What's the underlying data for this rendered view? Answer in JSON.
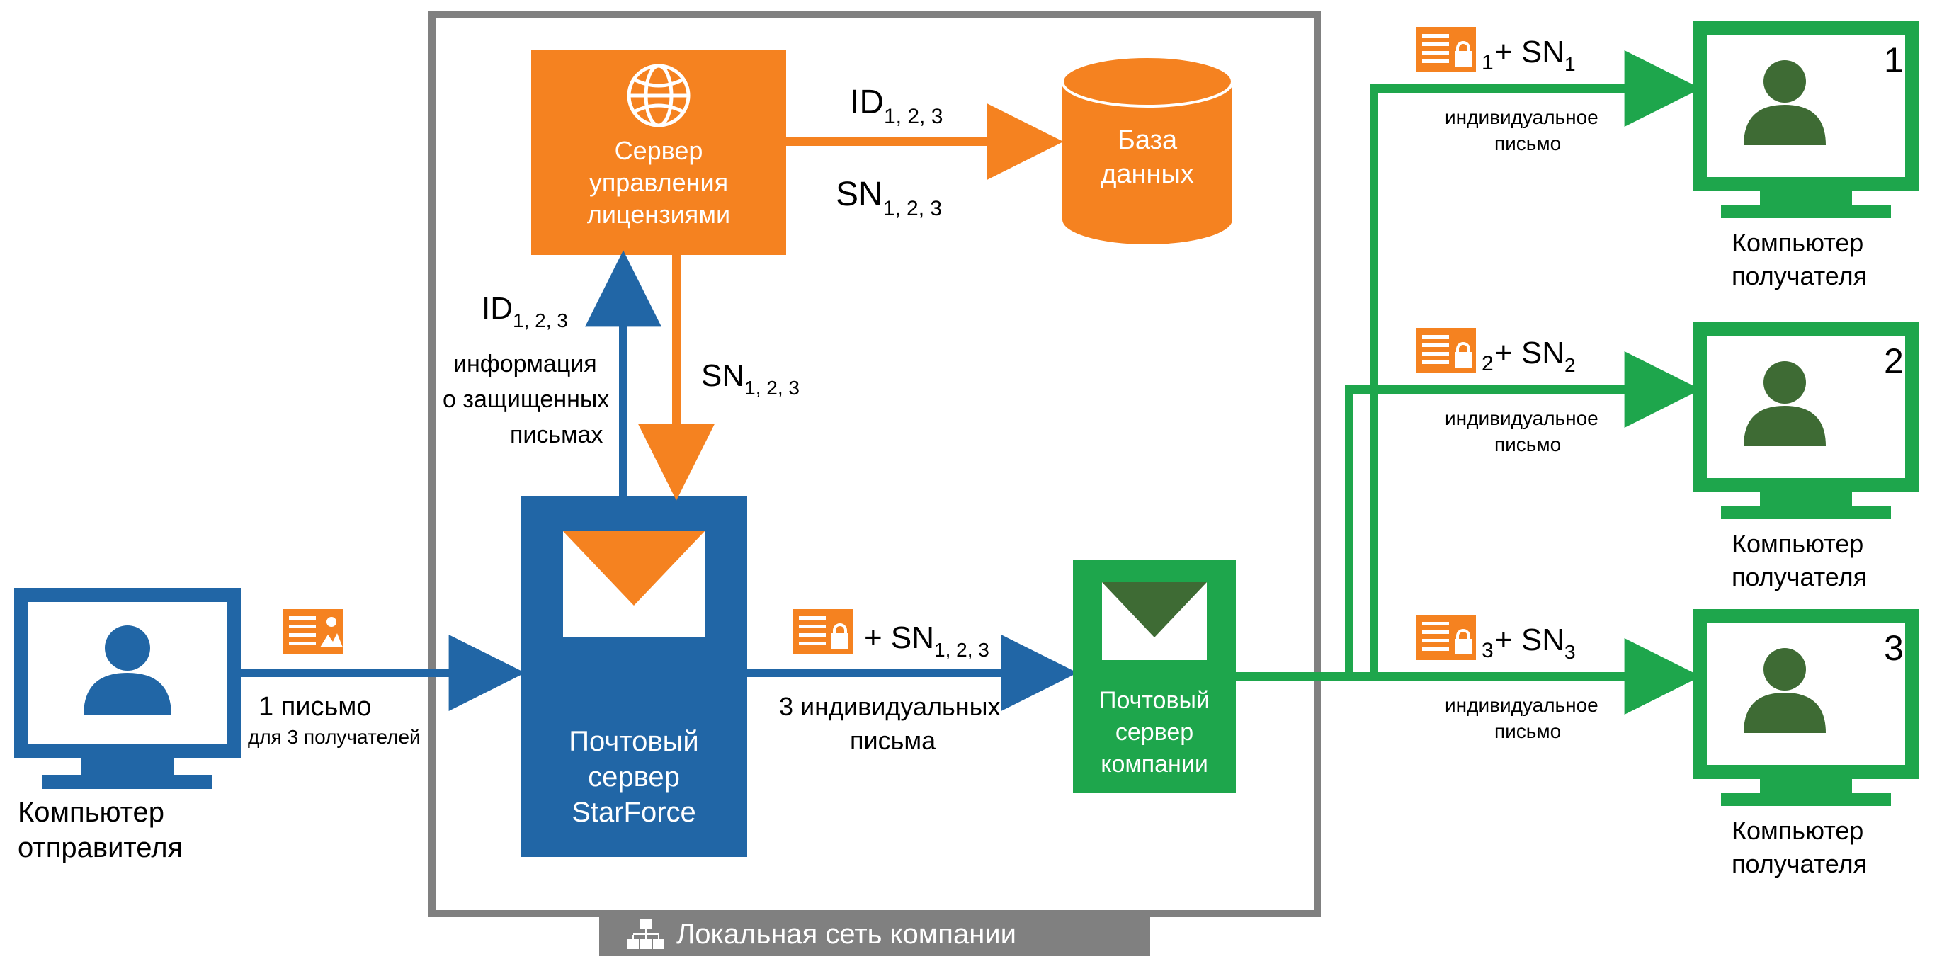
{
  "colors": {
    "blue": "#2166a6",
    "orange": "#f58220",
    "green": "#1ea64c",
    "darkgreen": "#3e6b34",
    "gray": "#808080",
    "text": "#000000",
    "white": "#ffffff"
  },
  "lan_box_title": "Локальная сеть компании",
  "sender_label": "Компьютер\nотправителя",
  "sender_arrow_line1": "1 письмо",
  "sender_arrow_line2": "для 3 получателей",
  "starforce_server_label": "Почтовый\nсервер\nStarForce",
  "license_server_label": "Сервер\nуправления\nлицензиями",
  "db_label": "База\nданных",
  "up_label_id": "ID",
  "up_label_id_sub": "1, 2, 3",
  "up_label_info_l1": "информация",
  "up_label_info_l2": "о защищенных",
  "up_label_info_l3": "письмах",
  "down_label_sn": "SN",
  "down_label_sn_sub": "1, 2, 3",
  "db_arrow_id": "ID",
  "db_arrow_id_sub": "1, 2, 3",
  "db_arrow_sn": "SN",
  "db_arrow_sn_sub": "1, 2, 3",
  "mid_arrow_sn": "+ SN",
  "mid_arrow_sn_sub": "1, 2, 3",
  "mid_arrow_label_l1": "3 индивидуальных",
  "mid_arrow_label_l2": "письма",
  "company_server_label": "Почтовый\nсервер\nкомпании",
  "recipients": [
    {
      "sn_sub": "1",
      "sn_prefix": "+ SN",
      "sub_label": "индивидуальное\nписьмо",
      "num": "1",
      "label": "Компьютер\nполучателя"
    },
    {
      "sn_sub": "2",
      "sn_prefix": "+ SN",
      "sub_label": "индивидуальное\nписьмо",
      "num": "2",
      "label": "Компьютер\nполучателя"
    },
    {
      "sn_sub": "3",
      "sn_prefix": "+ SN",
      "sub_label": "индивидуальное\nписьмо",
      "num": "3",
      "label": "Компьютер\nполучателя"
    }
  ]
}
